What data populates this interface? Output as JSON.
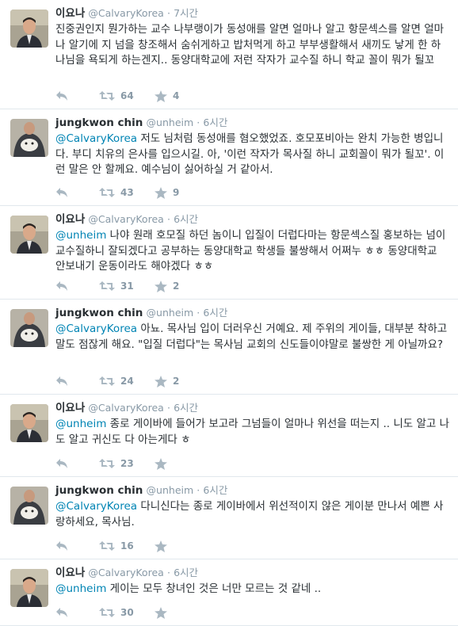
{
  "tweets": [
    {
      "name": "이요나",
      "handle": "@CalvaryKorea",
      "time": "7시간",
      "mention": "",
      "text": "진중권인지 뭔가하는 교수 나부랭이가 동성애를 알면 얼마나 알고 항문섹스를 알면 얼마나 알기에 지 넘을 창조해서 숨쉬게하고 밥처먹게 하고 부부생활해서 새끼도 낳게 한 하나님을 욕되게 하는겐지.. 동양대학교에 저런 작자가 교수질 하니 학교 꼴이 뭐가 될꼬",
      "retweets": "64",
      "favorites": "4",
      "avatar": "pastor"
    },
    {
      "name": "jungkwon chin",
      "handle": "@unheim",
      "time": "6시간",
      "mention": "@CalvaryKorea",
      "text": " 저도 님처럼 동성애를 혐오했었죠. 호모포비아는 완치 가능한 병입니다. 부디 치유의 은사를 입으시길. 아, '이런 작자가 목사질 하니 교회꼴이 뭐가 될꼬'. 이런 말은 안 할께요. 예수님이 싫어하실 거 같아서.",
      "retweets": "43",
      "favorites": "9",
      "avatar": "dog"
    },
    {
      "name": "이요나",
      "handle": "@CalvaryKorea",
      "time": "6시간",
      "mention": "@unheim",
      "text": " 나야 원래 호모질 하던 놈이니 입질이 더럽다마는 항문섹스질 홍보하는 넘이 교수질하니 잘되겠다고 공부하는 동양대학교 학생들 불쌍해서 어쩌누 ㅎㅎ 동양대학교 안보내기 운동이라도 해야겠다 ㅎㅎ",
      "retweets": "31",
      "favorites": "2",
      "avatar": "pastor"
    },
    {
      "name": "jungkwon chin",
      "handle": "@unheim",
      "time": "6시간",
      "mention": "@CalvaryKorea",
      "text": " 아뇨. 목사님 입이 더러우신 거예요. 제 주위의 게이들, 대부분 착하고 말도 점잖게 해요. \"입질 더럽다\"는 목사님 교회의 신도들이야말로 불쌍한 게 아닐까요?",
      "retweets": "24",
      "favorites": "2",
      "avatar": "dog"
    },
    {
      "name": "이요나",
      "handle": "@CalvaryKorea",
      "time": "6시간",
      "mention": "@unheim",
      "text": " 종로 게이바에 들어가 보고라 그넘들이 얼마나 위선을 떠는지 .. 니도 알고 나도 알고 귀신도 다 아는게다 ㅎ",
      "retweets": "23",
      "favorites": "",
      "avatar": "pastor"
    },
    {
      "name": "jungkwon chin",
      "handle": "@unheim",
      "time": "6시간",
      "mention": "@CalvaryKorea",
      "text": " 다니신다는 종로 게이바에서 위선적이지 않은 게이분 만나서 예쁜 사랑하세요, 목사님.",
      "retweets": "16",
      "favorites": "",
      "avatar": "dog"
    },
    {
      "name": "이요나",
      "handle": "@CalvaryKorea",
      "time": "6시간",
      "mention": "@unheim",
      "text": " 게이는 모두 창녀인 것은 너만 모르는 것 같네 ..",
      "retweets": "30",
      "favorites": "",
      "avatar": "pastor"
    }
  ],
  "dot": "·",
  "colors": {
    "link": "#0084b4",
    "muted": "#8899a6",
    "divider": "#e1e8ed"
  }
}
